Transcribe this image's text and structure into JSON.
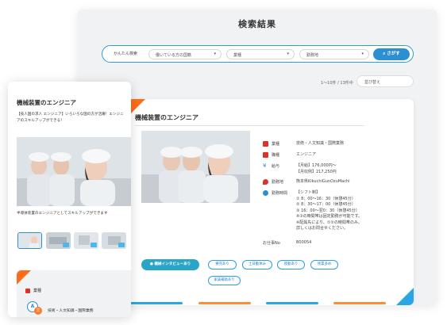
{
  "desktop": {
    "title": "検索結果",
    "search": {
      "label": "かんたん検索",
      "selects": [
        "働いている方の国籍",
        "業種",
        "勤務地"
      ],
      "button": "さがす"
    },
    "result_count": "1〜10件 / 13件中",
    "sort_label": "並び替え",
    "card": {
      "title": "機械装置のエンジニア",
      "details": [
        {
          "icon": "briefcase-icon",
          "label": "業種",
          "value": "技術・人文知識・国際業務",
          "color": "#d8352a"
        },
        {
          "icon": "briefcase-icon",
          "label": "職種",
          "value": "エンジニア",
          "color": "#d8352a"
        },
        {
          "icon": "yen-icon",
          "label": "給与",
          "value": "【月給】176,000円〜\n【月収例】217,250円",
          "color": "#2b8fd2"
        },
        {
          "icon": "pin-icon",
          "label": "勤務地",
          "value": "熊本県KikuchiGunOzuMachi",
          "color": "#d8352a"
        },
        {
          "icon": "clock-icon",
          "label": "勤務時間",
          "value": "【シフト制】\n① 8：00〜16：30（休憩45分）\n② 8：30〜17：00（休憩45分）\n③ 16：00〜翌0：30（休憩45分）\n※③の時間帯は固定勤務が可能です。\n※配属先により、①②の時間帯のみ。\n詳しくはお問合せください。",
          "color": "#2b8fd2"
        },
        {
          "icon": "",
          "label": "お仕事No",
          "value": "B00054",
          "color": ""
        }
      ],
      "main_tag": "機械インタビューあり",
      "tags": [
        "寮完あり",
        "土日勤休み",
        "夜勤あり",
        "残業多め",
        "家賃補助あり"
      ]
    },
    "strip_colors": [
      "#2aa5e6",
      "#ff8a3a",
      "#2aa5e6",
      "#ff8a3a"
    ]
  },
  "mobile": {
    "title": "機械装置のエンジニア",
    "description": "【技人国の求人 エンジニア】いろいろな国の方が活躍！エンジニアのスキルアップができる！",
    "caption": "半導体装置のエンジニアとしてスキルアップができます",
    "thumbs": 4,
    "bottom": {
      "label": "業種",
      "badge": "A",
      "badge2": "文",
      "value": "技術・人文知識・国際業務"
    }
  },
  "colors": {
    "accent_blue": "#2b8fd2",
    "accent_orange": "#ff6b1a",
    "bg_gray": "#f1f2f4"
  }
}
